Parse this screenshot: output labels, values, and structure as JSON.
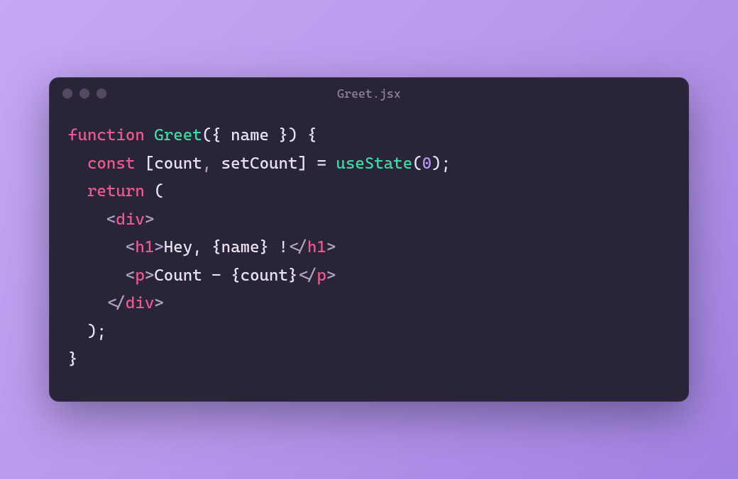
{
  "window": {
    "title": "Greet.jsx"
  },
  "code": {
    "line1": {
      "kw_function": "function",
      "fn_name": "Greet",
      "paren_open": "(",
      "destruct_open": "{ ",
      "param": "name",
      "destruct_close": " }",
      "paren_close": ")",
      "brace_open": " {"
    },
    "line2": {
      "indent": "  ",
      "kw_const": "const",
      "sp1": " ",
      "bracket_open": "[",
      "id1": "count",
      "comma": ",",
      "sp2": " ",
      "id2": "setCount",
      "bracket_close": "]",
      "sp3": " ",
      "eq": "=",
      "sp4": " ",
      "fn_call": "useState",
      "call_open": "(",
      "num": "0",
      "call_close": ")",
      "semi": ";"
    },
    "line3": {
      "indent": "  ",
      "kw_return": "return",
      "sp": " ",
      "paren": "("
    },
    "line4": {
      "indent": "    ",
      "lt": "<",
      "tag": "div",
      "gt": ">"
    },
    "line5": {
      "indent": "      ",
      "lt": "<",
      "tag": "h1",
      "gt": ">",
      "text1": "Hey, ",
      "expr": "{name}",
      "text2": " !",
      "lt_close": "</",
      "tag_close": "h1",
      "gt_close": ">"
    },
    "line6": {
      "indent": "      ",
      "lt": "<",
      "tag": "p",
      "gt": ">",
      "text1": "Count - ",
      "expr": "{count}",
      "lt_close": "</",
      "tag_close": "p",
      "gt_close": ">"
    },
    "line7": {
      "indent": "    ",
      "lt": "</",
      "tag": "div",
      "gt": ">"
    },
    "line8": {
      "indent": "  ",
      "paren": ")",
      "semi": ";"
    },
    "line9": {
      "brace_close": "}"
    }
  }
}
